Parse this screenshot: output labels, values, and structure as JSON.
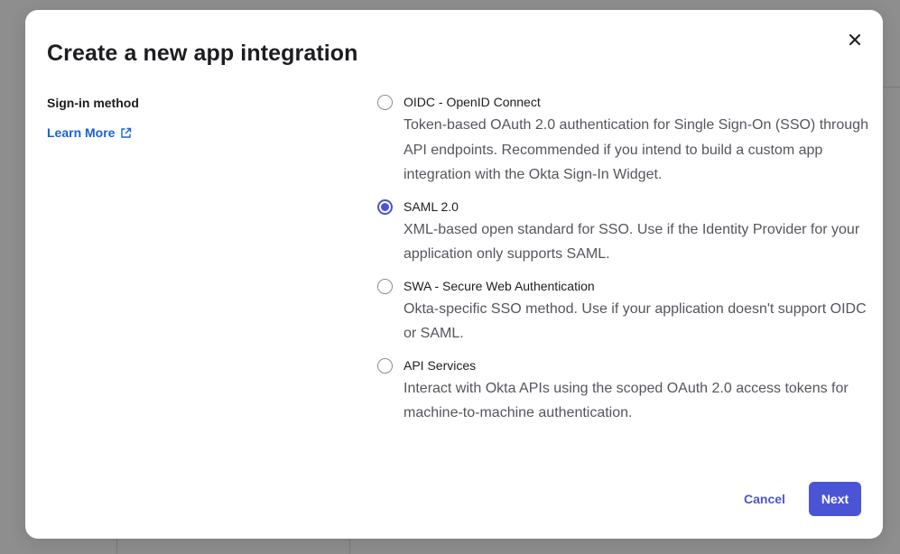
{
  "dialog": {
    "title": "Create a new app integration",
    "close_icon": "close-icon"
  },
  "sign_in": {
    "label": "Sign-in method",
    "learn_more": "Learn More",
    "learn_more_icon": "external-link-icon"
  },
  "options": [
    {
      "label": "OIDC - OpenID Connect",
      "description": "Token-based OAuth 2.0 authentication for Single Sign-On (SSO) through API endpoints. Recommended if you intend to build a custom app integration with the Okta Sign-In Widget.",
      "selected": false
    },
    {
      "label": "SAML 2.0",
      "description": "XML-based open standard for SSO. Use if the Identity Provider for your application only supports SAML.",
      "selected": true
    },
    {
      "label": "SWA - Secure Web Authentication",
      "description": "Okta-specific SSO method. Use if your application doesn't support OIDC or SAML.",
      "selected": false
    },
    {
      "label": "API Services",
      "description": "Interact with Okta APIs using the scoped OAuth 2.0 access tokens for machine-to-machine authentication.",
      "selected": false
    }
  ],
  "footer": {
    "cancel_label": "Cancel",
    "next_label": "Next"
  },
  "colors": {
    "accent": "#4a55d6",
    "link": "#1662dd",
    "overlay": "#8e8e8e"
  }
}
